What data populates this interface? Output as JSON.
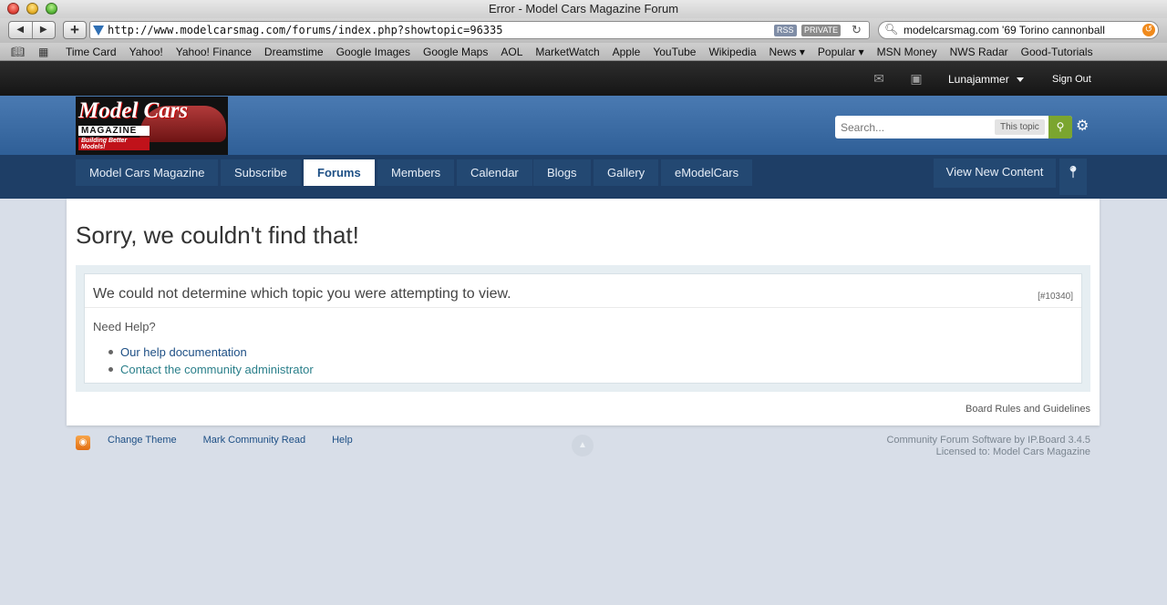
{
  "window": {
    "title": "Error - Model Cars Magazine Forum"
  },
  "browser": {
    "url": "http://www.modelcarsmag.com/forums/index.php?showtopic=96335",
    "rss_label": "RSS",
    "private_label": "PRIVATE",
    "search_query": "modelcarsmag.com '69 Torino cannonball",
    "bookmarks": [
      "Time Card",
      "Yahoo!",
      "Yahoo! Finance",
      "Dreamstime",
      "Google Images",
      "Google Maps",
      "AOL",
      "MarketWatch",
      "Apple",
      "YouTube",
      "Wikipedia",
      "News ▾",
      "Popular ▾",
      "MSN Money",
      "NWS Radar",
      "Good-Tutorials"
    ]
  },
  "userbar": {
    "username": "Lunajammer",
    "signout": "Sign Out"
  },
  "header": {
    "logo_line1": "Model Cars",
    "logo_line2": "MAGAZINE",
    "logo_line3": "Building Better Models!",
    "search_placeholder": "Search...",
    "search_scope": "This topic"
  },
  "nav": {
    "tabs": [
      "Model Cars Magazine",
      "Subscribe",
      "Forums",
      "Members",
      "Calendar",
      "Blogs",
      "Gallery",
      "eModelCars"
    ],
    "active": "Forums",
    "view_new": "View New Content"
  },
  "error": {
    "title": "Sorry, we couldn't find that!",
    "message": "We could not determine which topic you were attempting to view.",
    "code": "[#10340]",
    "need_help": "Need Help?",
    "links": [
      "Our help documentation",
      "Contact the community administrator"
    ],
    "board_rules": "Board Rules and Guidelines"
  },
  "footer": {
    "links": [
      "Change Theme",
      "Mark Community Read",
      "Help"
    ],
    "software": "Community Forum Software by IP.Board 3.4.5",
    "license": "Licensed to: Model Cars Magazine"
  }
}
